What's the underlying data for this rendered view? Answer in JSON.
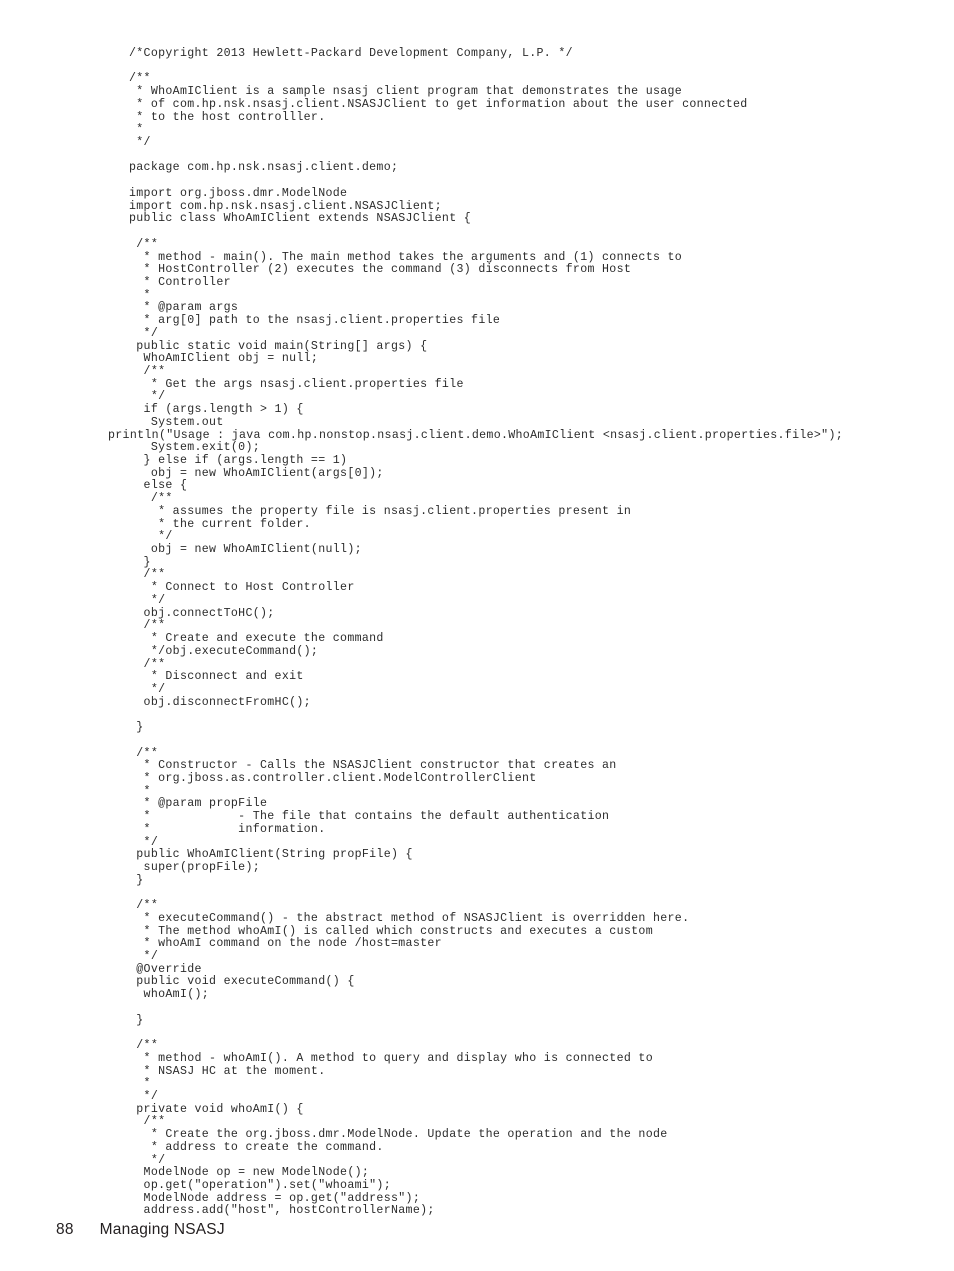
{
  "document": {
    "footer": {
      "page_number": "88",
      "running_head": "Managing NSASJ"
    }
  },
  "code_listing": {
    "language": "java",
    "lines": [
      {
        "text": "/*Copyright 2013 Hewlett-Packard Development Company, L.P. */",
        "hang": false
      },
      {
        "text": "",
        "hang": false
      },
      {
        "text": "/**",
        "hang": false
      },
      {
        "text": " * WhoAmIClient is a sample nsasj client program that demonstrates the usage",
        "hang": false
      },
      {
        "text": " * of com.hp.nsk.nsasj.client.NSASJClient to get information about the user connected",
        "hang": false
      },
      {
        "text": " * to the host controlller.",
        "hang": false
      },
      {
        "text": " *",
        "hang": false
      },
      {
        "text": " */",
        "hang": false
      },
      {
        "text": "",
        "hang": false
      },
      {
        "text": "package com.hp.nsk.nsasj.client.demo;",
        "hang": false
      },
      {
        "text": "",
        "hang": false
      },
      {
        "text": "import org.jboss.dmr.ModelNode",
        "hang": false
      },
      {
        "text": "import com.hp.nsk.nsasj.client.NSASJClient;",
        "hang": false
      },
      {
        "text": "public class WhoAmIClient extends NSASJClient {",
        "hang": false
      },
      {
        "text": "",
        "hang": false
      },
      {
        "text": " /**",
        "hang": false
      },
      {
        "text": "  * method - main(). The main method takes the arguments and (1) connects to",
        "hang": false
      },
      {
        "text": "  * HostController (2) executes the command (3) disconnects from Host",
        "hang": false
      },
      {
        "text": "  * Controller",
        "hang": false
      },
      {
        "text": "  *",
        "hang": false
      },
      {
        "text": "  * @param args",
        "hang": false
      },
      {
        "text": "  * arg[0] path to the nsasj.client.properties file",
        "hang": false
      },
      {
        "text": "  */",
        "hang": false
      },
      {
        "text": " public static void main(String[] args) {",
        "hang": false
      },
      {
        "text": "  WhoAmIClient obj = null;",
        "hang": false
      },
      {
        "text": "  /**",
        "hang": false
      },
      {
        "text": "   * Get the args nsasj.client.properties file",
        "hang": false
      },
      {
        "text": "   */",
        "hang": false
      },
      {
        "text": "  if (args.length > 1) {",
        "hang": false
      },
      {
        "text": "   System.out",
        "hang": false
      },
      {
        "text": "println(\"Usage : java com.hp.nonstop.nsasj.client.demo.WhoAmIClient <nsasj.client.properties.file>\");",
        "hang": true
      },
      {
        "text": "   System.exit(0);",
        "hang": false
      },
      {
        "text": "  } else if (args.length == 1)",
        "hang": false
      },
      {
        "text": "   obj = new WhoAmIClient(args[0]);",
        "hang": false
      },
      {
        "text": "  else {",
        "hang": false
      },
      {
        "text": "   /**",
        "hang": false
      },
      {
        "text": "    * assumes the property file is nsasj.client.properties present in",
        "hang": false
      },
      {
        "text": "    * the current folder.",
        "hang": false
      },
      {
        "text": "    */",
        "hang": false
      },
      {
        "text": "   obj = new WhoAmIClient(null);",
        "hang": false
      },
      {
        "text": "  }",
        "hang": false
      },
      {
        "text": "  /**",
        "hang": false
      },
      {
        "text": "   * Connect to Host Controller",
        "hang": false
      },
      {
        "text": "   */",
        "hang": false
      },
      {
        "text": "  obj.connectToHC();",
        "hang": false
      },
      {
        "text": "  /**",
        "hang": false
      },
      {
        "text": "   * Create and execute the command",
        "hang": false
      },
      {
        "text": "   */obj.executeCommand();",
        "hang": false
      },
      {
        "text": "  /**",
        "hang": false
      },
      {
        "text": "   * Disconnect and exit",
        "hang": false
      },
      {
        "text": "   */",
        "hang": false
      },
      {
        "text": "  obj.disconnectFromHC();",
        "hang": false
      },
      {
        "text": "",
        "hang": false
      },
      {
        "text": " }",
        "hang": false
      },
      {
        "text": "",
        "hang": false
      },
      {
        "text": " /**",
        "hang": false
      },
      {
        "text": "  * Constructor - Calls the NSASJClient constructor that creates an",
        "hang": false
      },
      {
        "text": "  * org.jboss.as.controller.client.ModelControllerClient",
        "hang": false
      },
      {
        "text": "  *",
        "hang": false
      },
      {
        "text": "  * @param propFile",
        "hang": false
      },
      {
        "text": "  *            - The file that contains the default authentication",
        "hang": false
      },
      {
        "text": "  *            information.",
        "hang": false
      },
      {
        "text": "  */",
        "hang": false
      },
      {
        "text": " public WhoAmIClient(String propFile) {",
        "hang": false
      },
      {
        "text": "  super(propFile);",
        "hang": false
      },
      {
        "text": " }",
        "hang": false
      },
      {
        "text": "",
        "hang": false
      },
      {
        "text": " /**",
        "hang": false
      },
      {
        "text": "  * executeCommand() - the abstract method of NSASJClient is overridden here.",
        "hang": false
      },
      {
        "text": "  * The method whoAmI() is called which constructs and executes a custom",
        "hang": false
      },
      {
        "text": "  * whoAmI command on the node /host=master",
        "hang": false
      },
      {
        "text": "  */",
        "hang": false
      },
      {
        "text": " @Override",
        "hang": false
      },
      {
        "text": " public void executeCommand() {",
        "hang": false
      },
      {
        "text": "  whoAmI();",
        "hang": false
      },
      {
        "text": "",
        "hang": false
      },
      {
        "text": " }",
        "hang": false
      },
      {
        "text": "",
        "hang": false
      },
      {
        "text": " /**",
        "hang": false
      },
      {
        "text": "  * method - whoAmI(). A method to query and display who is connected to",
        "hang": false
      },
      {
        "text": "  * NSASJ HC at the moment.",
        "hang": false
      },
      {
        "text": "  *",
        "hang": false
      },
      {
        "text": "  */",
        "hang": false
      },
      {
        "text": " private void whoAmI() {",
        "hang": false
      },
      {
        "text": "  /**",
        "hang": false
      },
      {
        "text": "   * Create the org.jboss.dmr.ModelNode. Update the operation and the node",
        "hang": false
      },
      {
        "text": "   * address to create the command.",
        "hang": false
      },
      {
        "text": "   */",
        "hang": false
      },
      {
        "text": "  ModelNode op = new ModelNode();",
        "hang": false
      },
      {
        "text": "  op.get(\"operation\").set(\"whoami\");",
        "hang": false
      },
      {
        "text": "  ModelNode address = op.get(\"address\");",
        "hang": false
      },
      {
        "text": "  address.add(\"host\", hostControllerName);",
        "hang": false
      }
    ]
  }
}
